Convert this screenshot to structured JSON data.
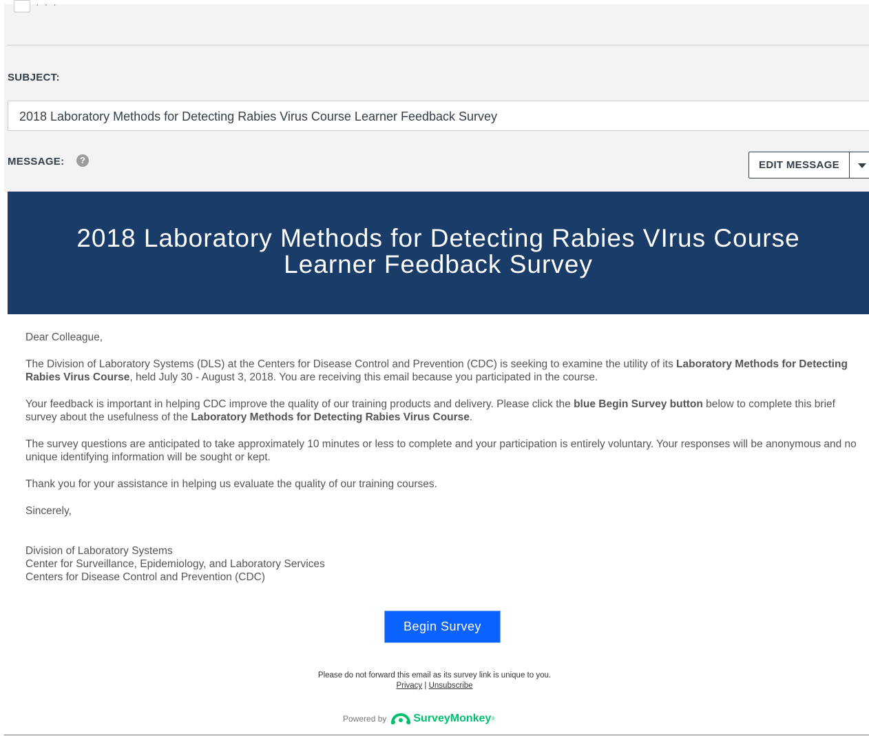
{
  "form": {
    "subject_label": "SUBJECT:",
    "subject_value": "2018 Laboratory Methods for Detecting Rabies Virus Course Learner Feedback Survey",
    "message_label": "MESSAGE:",
    "help_glyph": "?",
    "edit_message_label": "EDIT MESSAGE"
  },
  "email": {
    "banner_title_line1": "2018 Laboratory Methods for Detecting Rabies VIrus Course",
    "banner_title_line2": "Learner Feedback Survey",
    "banner_color": "#1a3c68",
    "greeting": "Dear Colleague,",
    "p1_part1": "The Division of Laboratory Systems (DLS) at the Centers for Disease Control and Prevention (CDC) is seeking to examine the utility of its ",
    "p1_bold": "Laboratory Methods for Detecting Rabies Virus Course",
    "p1_part2": ", held July 30 - August 3, 2018. You are receiving this email because you participated in the course.",
    "p2_part1": "Your feedback is important in helping CDC improve the quality of our training products and delivery.  Please click the ",
    "p2_bold1": "blue Begin Survey button",
    "p2_part2": " below to complete this brief survey about the usefulness of the ",
    "p2_bold2": "Laboratory Methods for Detecting Rabies Virus Course",
    "p2_part3": ".",
    "p3": "The survey questions are anticipated to take approximately 10 minutes or less to complete and your participation is entirely voluntary. Your responses will be anonymous and no unique identifying information will be sought or kept.",
    "p4": "Thank you for your assistance in helping us evaluate the quality of our training courses.",
    "closing": "Sincerely,",
    "sig_line1": "Division of Laboratory Systems",
    "sig_line2": "Center for Surveillance, Epidemiology, and Laboratory Services",
    "sig_line3": "Centers for Disease Control and Prevention (CDC)",
    "begin_button_label": "Begin Survey",
    "begin_button_color": "#0b63ff",
    "footer_note": "Please do not forward this email as its survey link is unique to you.",
    "privacy_link": "Privacy",
    "link_separator": "|",
    "unsubscribe_link": "Unsubscribe",
    "powered_by": "Powered by",
    "brand_name": "SurveyMonkey",
    "brand_tm": "®",
    "brand_color": "#00bf6f"
  }
}
